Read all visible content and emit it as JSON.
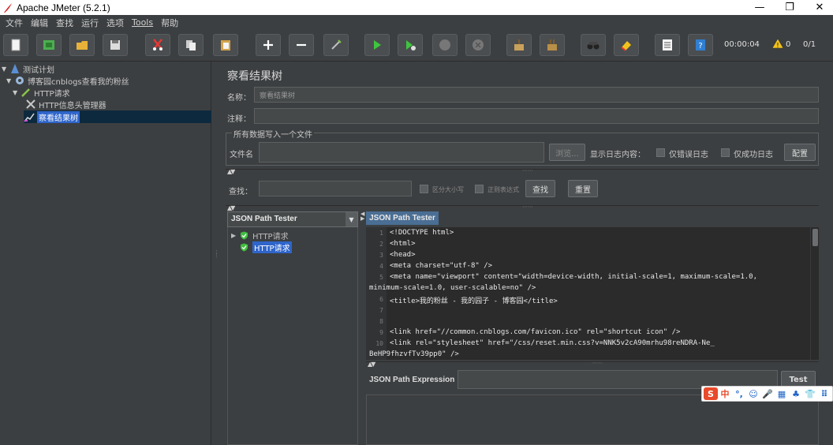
{
  "window": {
    "title": "Apache JMeter (5.2.1)",
    "minimize": "—",
    "maximize": "❐",
    "close": "✕"
  },
  "menu": [
    "文件",
    "编辑",
    "查找",
    "运行",
    "选项",
    "Tools",
    "帮助"
  ],
  "toolbar": {
    "timer": "00:00:04",
    "warnings": "0",
    "threads": "0/1"
  },
  "tree": {
    "items": [
      {
        "label": "测试计划"
      },
      {
        "label": "博客园cnblogs查看我的粉丝"
      },
      {
        "label": "HTTP请求"
      },
      {
        "label": "HTTP信息头管理器"
      },
      {
        "label": "察看结果树"
      }
    ]
  },
  "panel": {
    "title": "察看结果树",
    "name_label": "名称：",
    "name_value": "察看结果树",
    "comment_label": "注释：",
    "file_section": "所有数据写入一个文件",
    "filename_label": "文件名",
    "browse": "浏览...",
    "log_label": "显示日志内容：",
    "errors_only": "仅错误日志",
    "success_only": "仅成功日志",
    "configure": "配置",
    "search_label": "查找：",
    "case_sensitive": "区分大小写",
    "regex": "正则表达式",
    "search_btn": "查找",
    "reset_btn": "重置"
  },
  "renderer": {
    "selected": "JSON Path Tester"
  },
  "results": [
    {
      "label": "HTTP请求"
    },
    {
      "label": "HTTP请求"
    }
  ],
  "tab": {
    "label": "JSON Path Tester"
  },
  "code": [
    {
      "n": "1",
      "text": "<!DOCTYPE html>"
    },
    {
      "n": "2",
      "text": "<html>"
    },
    {
      "n": "3",
      "text": "<head>"
    },
    {
      "n": "4",
      "text": "    <meta charset=\"utf-8\" />"
    },
    {
      "n": "5",
      "text": "    <meta name=\"viewport\" content=\"width=device-width, initial-scale=1, maximum-scale=1.0,"
    },
    {
      "n": "",
      "text": "minimum-scale=1.0, user-scalable=no\" />"
    },
    {
      "n": "6",
      "text": "    <title>我的粉丝 - 我的园子 - 博客园</title>"
    },
    {
      "n": "7",
      "text": ""
    },
    {
      "n": "8",
      "text": ""
    },
    {
      "n": "9",
      "text": "    <link href=\"//common.cnblogs.com/favicon.ico\" rel=\"shortcut icon\" />"
    },
    {
      "n": "10",
      "text": "    <link rel=\"stylesheet\" href=\"/css/reset.min.css?v=NNK5v2cA90mrhu98reNDRA-Ne_"
    },
    {
      "n": "",
      "text": "BeHP9fhzvfTv39pp0\" />"
    }
  ],
  "json_path": {
    "label": "JSON Path Expression",
    "test": "Test"
  },
  "ime": [
    "S",
    "中",
    "°,",
    "☺",
    "🎤",
    "▦",
    "♣",
    "👕",
    "⠿"
  ]
}
